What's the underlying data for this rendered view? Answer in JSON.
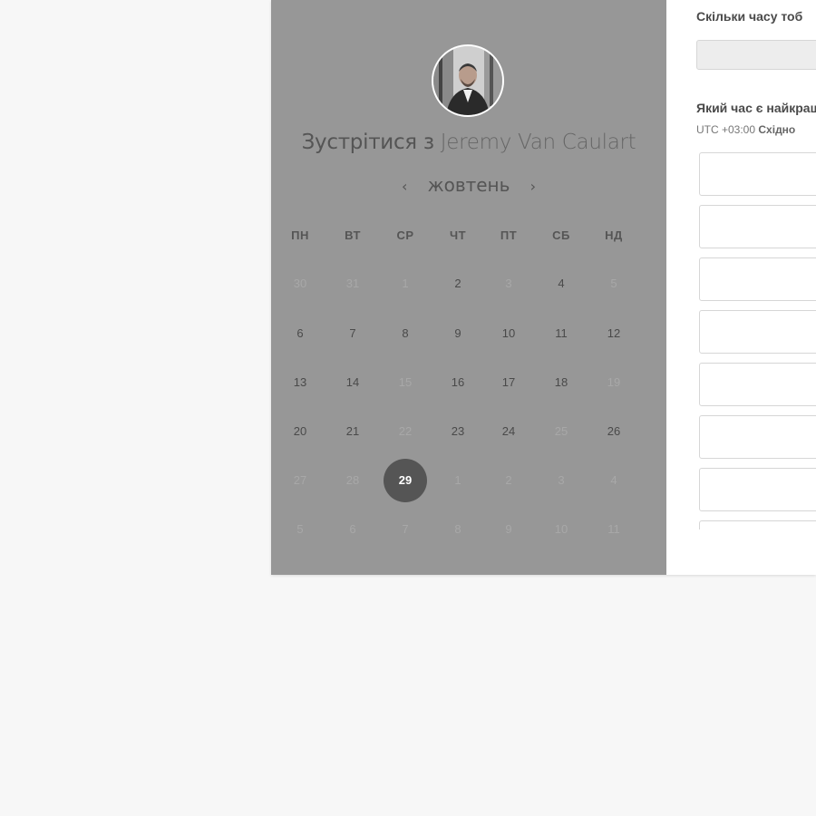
{
  "host": {
    "title_prefix": "Зустрітися з",
    "name": "Jeremy Van Caulart"
  },
  "calendar": {
    "month": "жовтень",
    "prev_icon": "‹",
    "next_icon": "›",
    "weekdays": [
      "ПН",
      "ВТ",
      "СР",
      "ЧТ",
      "ПТ",
      "СБ",
      "НД"
    ],
    "weeks": [
      [
        {
          "d": "30",
          "s": "disabled"
        },
        {
          "d": "31",
          "s": "disabled"
        },
        {
          "d": "1",
          "s": "disabled"
        },
        {
          "d": "2",
          "s": "available"
        },
        {
          "d": "3",
          "s": "disabled"
        },
        {
          "d": "4",
          "s": "available"
        },
        {
          "d": "5",
          "s": "disabled"
        }
      ],
      [
        {
          "d": "6",
          "s": "available"
        },
        {
          "d": "7",
          "s": "available"
        },
        {
          "d": "8",
          "s": "available"
        },
        {
          "d": "9",
          "s": "available"
        },
        {
          "d": "10",
          "s": "available"
        },
        {
          "d": "11",
          "s": "available"
        },
        {
          "d": "12",
          "s": "available"
        }
      ],
      [
        {
          "d": "13",
          "s": "available"
        },
        {
          "d": "14",
          "s": "available"
        },
        {
          "d": "15",
          "s": "disabled"
        },
        {
          "d": "16",
          "s": "available"
        },
        {
          "d": "17",
          "s": "available"
        },
        {
          "d": "18",
          "s": "available"
        },
        {
          "d": "19",
          "s": "disabled"
        }
      ],
      [
        {
          "d": "20",
          "s": "available"
        },
        {
          "d": "21",
          "s": "available"
        },
        {
          "d": "22",
          "s": "disabled"
        },
        {
          "d": "23",
          "s": "available"
        },
        {
          "d": "24",
          "s": "available"
        },
        {
          "d": "25",
          "s": "disabled"
        },
        {
          "d": "26",
          "s": "available"
        }
      ],
      [
        {
          "d": "27",
          "s": "disabled"
        },
        {
          "d": "28",
          "s": "disabled"
        },
        {
          "d": "29",
          "s": "selected"
        },
        {
          "d": "1",
          "s": "disabled"
        },
        {
          "d": "2",
          "s": "disabled"
        },
        {
          "d": "3",
          "s": "disabled"
        },
        {
          "d": "4",
          "s": "disabled"
        }
      ],
      [
        {
          "d": "5",
          "s": "disabled"
        },
        {
          "d": "6",
          "s": "disabled"
        },
        {
          "d": "7",
          "s": "disabled"
        },
        {
          "d": "8",
          "s": "disabled"
        },
        {
          "d": "9",
          "s": "disabled"
        },
        {
          "d": "10",
          "s": "disabled"
        },
        {
          "d": "11",
          "s": "disabled"
        }
      ]
    ]
  },
  "booking": {
    "duration_question": "Скільки часу тоб",
    "duration_value": "",
    "time_question": "Який час є найкращ",
    "timezone_offset": "UTC +03:00",
    "timezone_name": "Східно",
    "slot_count_visible": 8
  },
  "colors": {
    "page_bg": "#f7f7f7",
    "overlay_panel": "#979797",
    "selected_day": "#555555"
  }
}
